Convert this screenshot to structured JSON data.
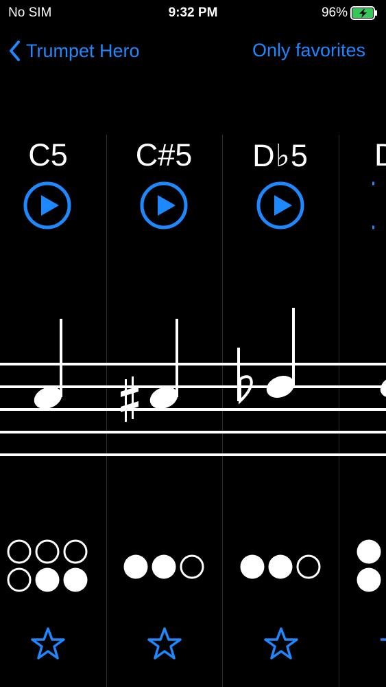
{
  "status_bar": {
    "carrier": "No SIM",
    "time": "9:32 PM",
    "battery_percent": "96%",
    "battery_level": 0.96,
    "battery_color": "#35c759",
    "charging_icon": "bolt-icon"
  },
  "nav": {
    "back_label": "Trumpet Hero",
    "back_icon": "chevron-left-icon",
    "right_label": "Only favorites",
    "accent_color": "#1e88ff"
  },
  "notes": [
    {
      "name": "C5",
      "fingering": [
        "open",
        "open",
        "open",
        "open",
        "closed",
        "closed"
      ]
    },
    {
      "name": "C#5",
      "fingering": [
        "closed",
        "closed",
        "open"
      ]
    },
    {
      "name": "Db5",
      "fingering": [
        "closed",
        "closed",
        "open"
      ]
    },
    {
      "name": "D",
      "fingering": [
        "closed",
        "closed"
      ]
    }
  ],
  "icons": {
    "play": "play-circle-icon",
    "favorite": "star-outline-icon",
    "sharp": "sharp-icon",
    "flat": "flat-icon"
  }
}
